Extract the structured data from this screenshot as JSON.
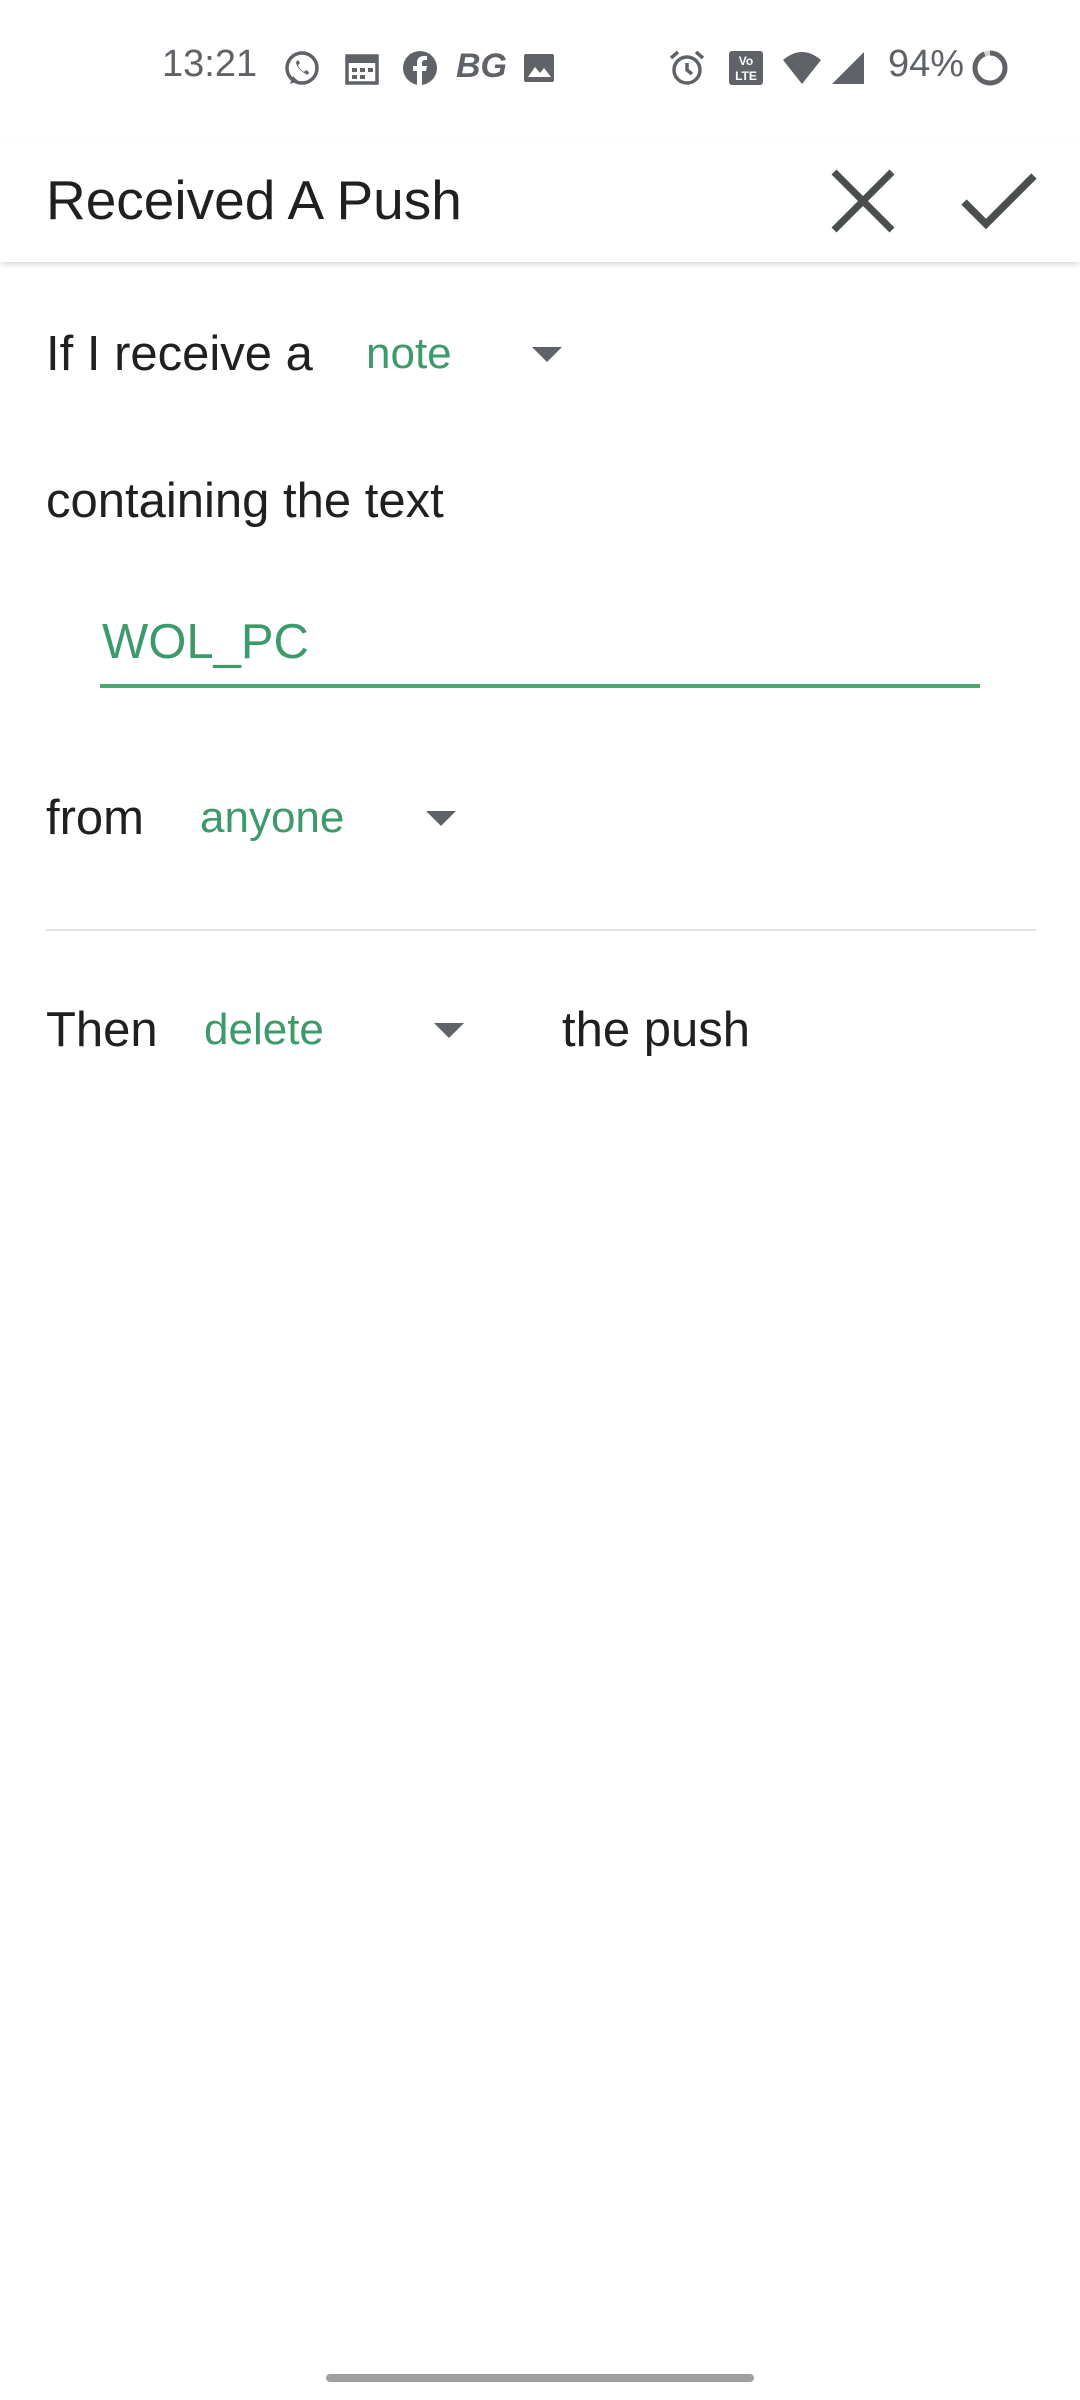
{
  "status_bar": {
    "time": "13:21",
    "notification_icons": [
      "whatsapp-icon",
      "calendar-icon",
      "facebook-icon",
      "bg-icon",
      "image-icon"
    ],
    "bg_label": "BG",
    "system_icons": [
      "alarm-icon",
      "volte-icon",
      "wifi-icon",
      "signal-icon",
      "battery-ring-icon"
    ],
    "battery": "94%"
  },
  "app_bar": {
    "title": "Received A Push",
    "close_icon": "close-icon",
    "confirm_icon": "check-icon"
  },
  "rule": {
    "trigger_prefix": "If I receive a",
    "push_type": "note",
    "containing_label": "containing the text",
    "text_value": "WOL_PC",
    "from_label": "from",
    "sender": "anyone",
    "then_label": "Then",
    "action": "delete",
    "action_suffix": "the push"
  },
  "colors": {
    "accent": "#3d9a6a",
    "underline": "#4aa76f",
    "text": "#202020",
    "icon": "#5f6368"
  }
}
